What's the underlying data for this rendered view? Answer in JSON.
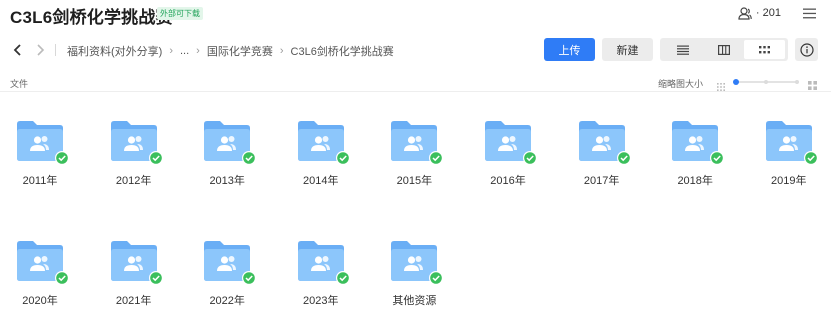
{
  "header": {
    "title": "C3L6剑桥化学挑战赛",
    "badge": "外部可下载",
    "member_count": "· 201",
    "member_icon": "users-icon",
    "menu_icon": "hamburger-menu-icon"
  },
  "toolbar": {
    "back_icon": "chevron-left-icon",
    "forward_icon": "chevron-right-icon",
    "breadcrumb": [
      {
        "label": "福利资料(对外分享)"
      },
      {
        "label": "..."
      },
      {
        "label": "国际化学竞赛"
      },
      {
        "label": "C3L6剑桥化学挑战赛"
      }
    ],
    "upload_label": "上传",
    "new_label": "新建",
    "views": [
      {
        "icon": "list-view-icon",
        "active": false
      },
      {
        "icon": "column-view-icon",
        "active": false
      },
      {
        "icon": "grid-view-icon",
        "active": true
      }
    ],
    "info_icon": "info-icon"
  },
  "subbar": {
    "column_label": "文件",
    "thumbnail_size_label": "缩略图大小",
    "thumbnail_size_level": 0
  },
  "folders": [
    {
      "name": "2011年"
    },
    {
      "name": "2012年"
    },
    {
      "name": "2013年"
    },
    {
      "name": "2014年"
    },
    {
      "name": "2015年"
    },
    {
      "name": "2016年"
    },
    {
      "name": "2017年"
    },
    {
      "name": "2018年"
    },
    {
      "name": "2019年"
    },
    {
      "name": "2020年"
    },
    {
      "name": "2021年"
    },
    {
      "name": "2022年"
    },
    {
      "name": "2023年"
    },
    {
      "name": "其他资源"
    }
  ],
  "colors": {
    "accent": "#2f7cf6",
    "folder_back": "#6aaef5",
    "folder_front": "#8cc6fb",
    "check": "#3bbf5c"
  }
}
